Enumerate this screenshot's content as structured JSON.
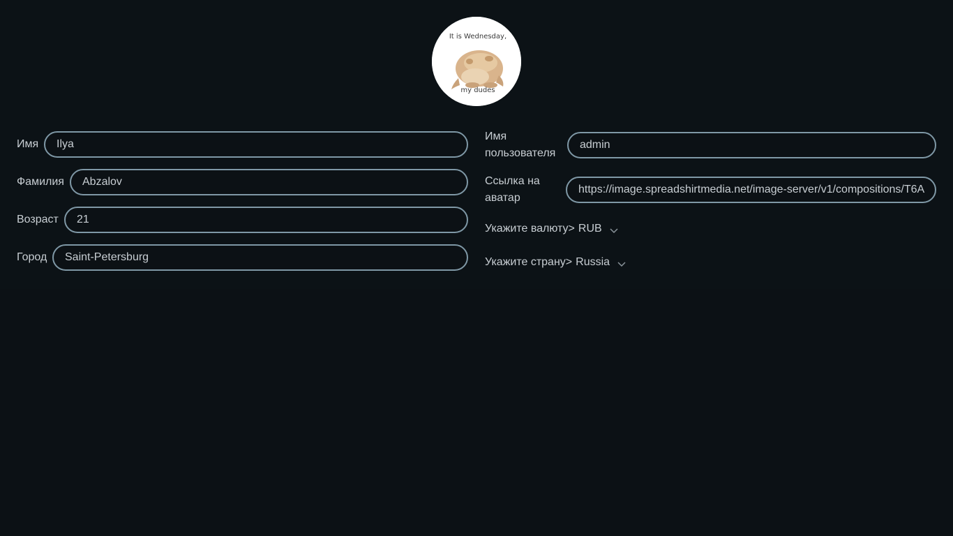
{
  "avatar": {
    "caption_top": "It is Wednesday,",
    "caption_bottom": "my dudes"
  },
  "form": {
    "first_name": {
      "label": "Имя",
      "value": "Ilya"
    },
    "last_name": {
      "label": "Фамилия",
      "value": "Abzalov"
    },
    "age": {
      "label": "Возраст",
      "value": "21"
    },
    "city": {
      "label": "Город",
      "value": "Saint-Petersburg"
    },
    "username": {
      "label_line1": "Имя",
      "label_line2": "пользователя",
      "value": "admin"
    },
    "avatar_link": {
      "label_line1": "Ссылка на",
      "label_line2": "аватар",
      "value": "https://image.spreadshirtmedia.net/image-server/v1/compositions/T6A"
    },
    "currency": {
      "label": "Укажите валюту>",
      "value": "RUB"
    },
    "country": {
      "label": "Укажите страну>",
      "value": "Russia"
    }
  },
  "colors": {
    "background": "#0c1115",
    "input_border": "#7f98a6",
    "text": "#c8ced3"
  }
}
